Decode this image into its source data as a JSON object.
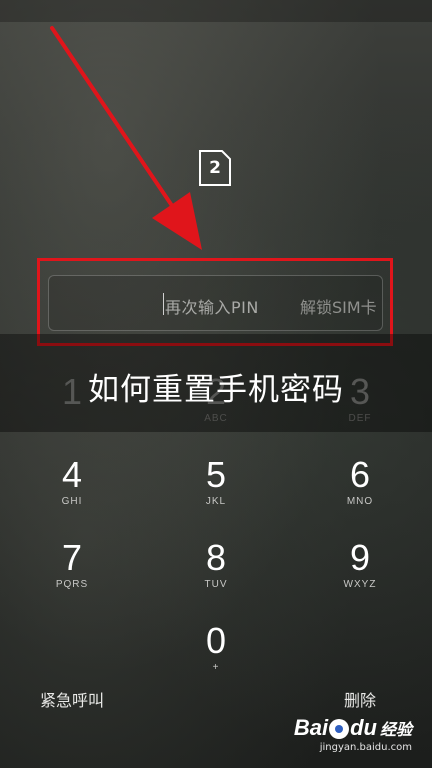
{
  "sim_icon": {
    "name": "sim-card-icon",
    "slot_number": "2"
  },
  "pin_field": {
    "placeholder": "再次输入PIN",
    "action_label": "解锁SIM卡"
  },
  "banner": {
    "title": "如何重置手机密码"
  },
  "keypad": [
    {
      "digit": "1",
      "letters": ""
    },
    {
      "digit": "2",
      "letters": "ABC"
    },
    {
      "digit": "3",
      "letters": "DEF"
    },
    {
      "digit": "4",
      "letters": "GHI"
    },
    {
      "digit": "5",
      "letters": "JKL"
    },
    {
      "digit": "6",
      "letters": "MNO"
    },
    {
      "digit": "7",
      "letters": "PQRS"
    },
    {
      "digit": "8",
      "letters": "TUV"
    },
    {
      "digit": "9",
      "letters": "WXYZ"
    },
    {
      "digit": "0",
      "letters": "+"
    }
  ],
  "bottom": {
    "emergency_call": "紧急呼叫",
    "delete": "删除"
  },
  "watermark": {
    "logo_text": "Bai",
    "logo_suffix": "du",
    "logo_cn": "经验",
    "url": "jingyan.baidu.com"
  },
  "colors": {
    "annotation_red": "#e0151b"
  }
}
